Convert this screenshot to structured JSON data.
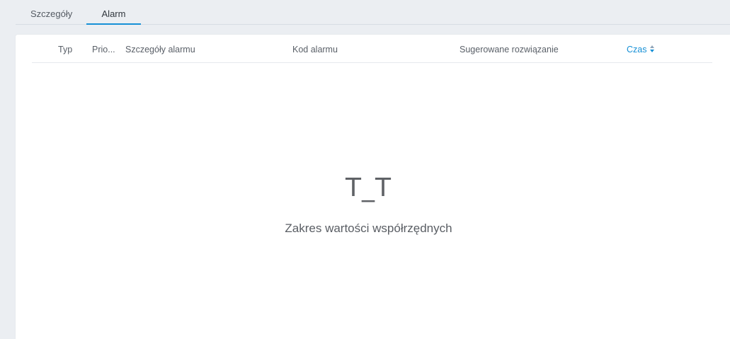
{
  "tabs": [
    {
      "label": "Szczegóły",
      "active": false
    },
    {
      "label": "Alarm",
      "active": true
    }
  ],
  "table": {
    "columns": [
      {
        "label": "Typ"
      },
      {
        "label": "Prio..."
      },
      {
        "label": "Szczegóły alarmu"
      },
      {
        "label": "Kod alarmu"
      },
      {
        "label": "Sugerowane rozwiązanie"
      },
      {
        "label": "Czas",
        "sorted": true,
        "sort_icon": "sort-caret-icon"
      }
    ],
    "rows": []
  },
  "empty_state": {
    "face": "T_T",
    "message": "Zakres wartości współrzędnych"
  },
  "colors": {
    "accent": "#1690d6",
    "background": "#ebeef2",
    "card": "#ffffff"
  }
}
